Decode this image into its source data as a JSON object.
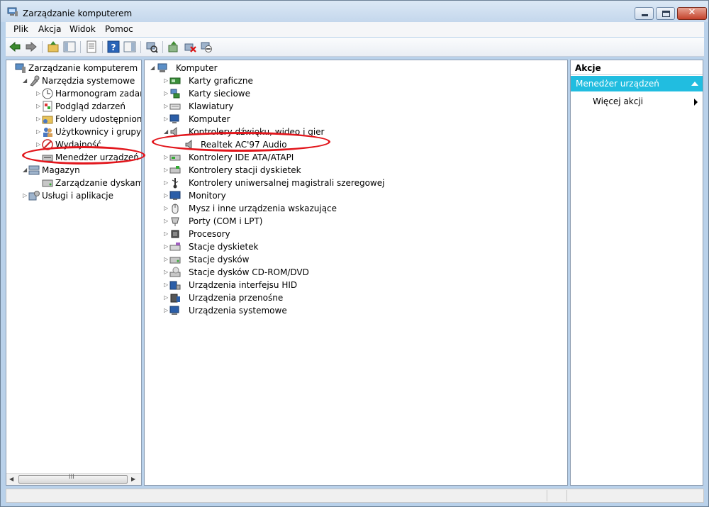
{
  "window": {
    "title": "Zarządzanie komputerem",
    "close_glyph": "✕"
  },
  "menu": [
    "Plik",
    "Akcja",
    "Widok",
    "Pomoc"
  ],
  "toolbar_icons": [
    "back-icon",
    "forward-icon",
    "up-folder-icon",
    "show-hide-tree-icon",
    "properties-icon",
    "help-icon",
    "show-hide-action-pane-icon",
    "scan-hardware-icon",
    "update-driver-icon",
    "uninstall-icon",
    "disable-icon"
  ],
  "left_tree": [
    {
      "label": "Zarządzanie komputerem (loka",
      "arrow": "",
      "icon": "computer-management-icon"
    },
    {
      "label": "Narzędzia systemowe",
      "arrow": "◢",
      "icon": "system-tools-icon"
    },
    {
      "label": "Harmonogram zadań",
      "arrow": "▷",
      "icon": "clock-icon"
    },
    {
      "label": "Podgląd zdarzeń",
      "arrow": "▷",
      "icon": "event-viewer-icon"
    },
    {
      "label": "Foldery udostępnione",
      "arrow": "▷",
      "icon": "shared-folders-icon"
    },
    {
      "label": "Użytkownicy i grupy lok",
      "arrow": "▷",
      "icon": "users-icon"
    },
    {
      "label": "Wydajność",
      "arrow": "▷",
      "icon": "performance-icon"
    },
    {
      "label": "Menedżer urządzeń",
      "arrow": "",
      "icon": "device-manager-icon"
    },
    {
      "label": "Magazyn",
      "arrow": "◢",
      "icon": "storage-icon"
    },
    {
      "label": "Zarządzanie dyskami",
      "arrow": "",
      "icon": "disk-management-icon"
    },
    {
      "label": "Usługi i aplikacje",
      "arrow": "▷",
      "icon": "services-icon"
    }
  ],
  "left_scroll": {
    "thumb_glyph": "III",
    "left": "◀",
    "right": "▶"
  },
  "device_tree": {
    "root": "Komputer",
    "root_arrow": "◢",
    "items": [
      {
        "label": "Karty graficzne",
        "arrow": "▷",
        "icon": "display-adapter-icon"
      },
      {
        "label": "Karty sieciowe",
        "arrow": "▷",
        "icon": "network-adapter-icon"
      },
      {
        "label": "Klawiatury",
        "arrow": "▷",
        "icon": "keyboard-icon"
      },
      {
        "label": "Komputer",
        "arrow": "▷",
        "icon": "computer-icon"
      },
      {
        "label": "Kontrolery dźwięku, wideo i gier",
        "arrow": "◢",
        "icon": "sound-icon"
      },
      {
        "label": "Kontrolery IDE ATA/ATAPI",
        "arrow": "▷",
        "icon": "ide-controller-icon"
      },
      {
        "label": "Kontrolery stacji dyskietek",
        "arrow": "▷",
        "icon": "floppy-controller-icon"
      },
      {
        "label": "Kontrolery uniwersalnej magistrali szeregowej",
        "arrow": "▷",
        "icon": "usb-icon"
      },
      {
        "label": "Monitory",
        "arrow": "▷",
        "icon": "monitor-icon"
      },
      {
        "label": "Mysz i inne urządzenia wskazujące",
        "arrow": "▷",
        "icon": "mouse-icon"
      },
      {
        "label": "Porty (COM i LPT)",
        "arrow": "▷",
        "icon": "port-icon"
      },
      {
        "label": "Procesory",
        "arrow": "▷",
        "icon": "processor-icon"
      },
      {
        "label": "Stacje dyskietek",
        "arrow": "▷",
        "icon": "floppy-drive-icon"
      },
      {
        "label": "Stacje dysków",
        "arrow": "▷",
        "icon": "disk-drive-icon"
      },
      {
        "label": "Stacje dysków CD-ROM/DVD",
        "arrow": "▷",
        "icon": "cdrom-icon"
      },
      {
        "label": "Urządzenia interfejsu HID",
        "arrow": "▷",
        "icon": "hid-icon"
      },
      {
        "label": "Urządzenia przenośne",
        "arrow": "▷",
        "icon": "portable-device-icon"
      },
      {
        "label": "Urządzenia systemowe",
        "arrow": "▷",
        "icon": "system-device-icon"
      }
    ],
    "selected_child": "Realtek AC'97 Audio"
  },
  "actions": {
    "title": "Akcje",
    "section": "Menedżer urządzeń",
    "more": "Więcej akcji"
  },
  "colors": {
    "accent": "#21bde0",
    "annotation": "#e2161c"
  }
}
